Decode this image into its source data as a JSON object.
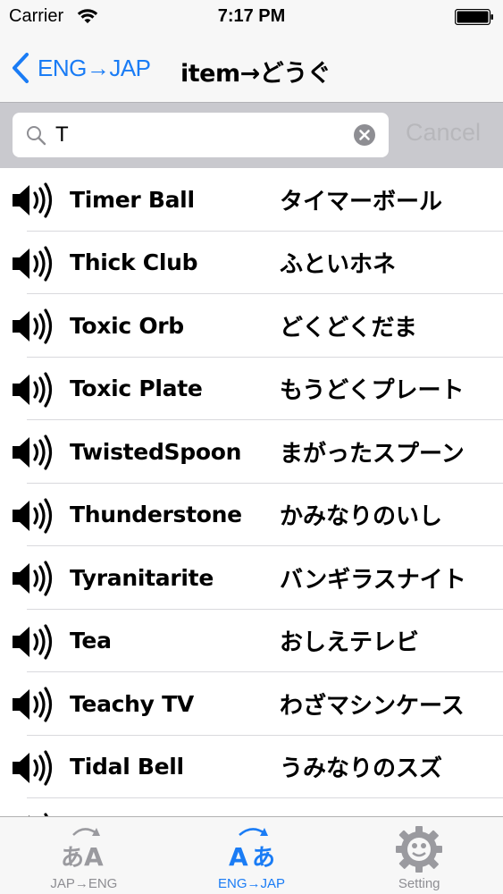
{
  "status_bar": {
    "carrier": "Carrier",
    "time": "7:17 PM"
  },
  "nav": {
    "back_label": "ENG→JAP",
    "title": "item→どうぐ"
  },
  "search": {
    "value": "T",
    "cancel_label": "Cancel"
  },
  "rows": [
    {
      "eng": "Timer Ball",
      "jap": "タイマーボール"
    },
    {
      "eng": "Thick Club",
      "jap": "ふといホネ"
    },
    {
      "eng": "Toxic Orb",
      "jap": "どくどくだま"
    },
    {
      "eng": "Toxic Plate",
      "jap": "もうどくプレート"
    },
    {
      "eng": "TwistedSpoon",
      "jap": "まがったスプーン"
    },
    {
      "eng": "Thunderstone",
      "jap": "かみなりのいし"
    },
    {
      "eng": "Tyranitarite",
      "jap": "バンギラスナイト"
    },
    {
      "eng": "Tea",
      "jap": "おしえテレビ"
    },
    {
      "eng": "Teachy TV",
      "jap": "わざマシンケース"
    },
    {
      "eng": "Tidal Bell",
      "jap": "うみなりのスズ"
    },
    {
      "eng": "",
      "jap": ""
    }
  ],
  "tabs": [
    {
      "label": "JAP→ENG",
      "glyph_a": "あ",
      "glyph_b": "A"
    },
    {
      "label": "ENG→JAP",
      "glyph_a": "A",
      "glyph_b": "あ"
    },
    {
      "label": "Setting"
    }
  ],
  "colors": {
    "accent": "#1a7cf5",
    "inactive": "#8e8e93",
    "search_bar_bg": "#c9c9ce"
  }
}
